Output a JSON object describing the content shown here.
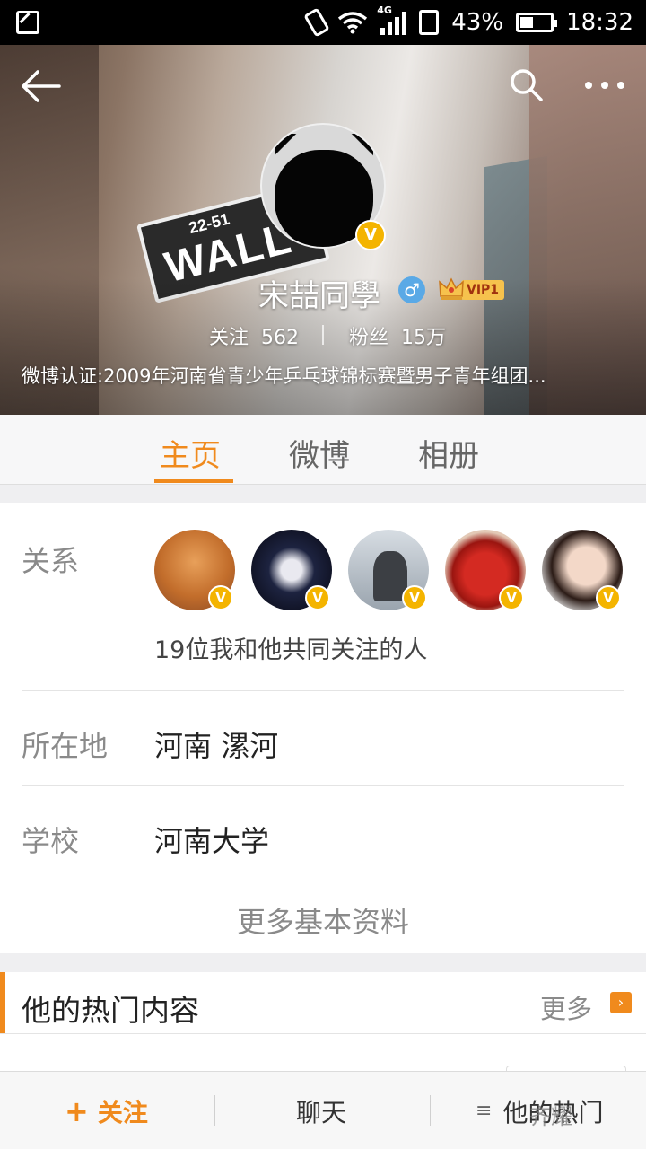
{
  "status_bar": {
    "network": "4G",
    "battery": "43%",
    "time": "18:32"
  },
  "header": {
    "street_sign_number": "22-51",
    "street_sign_name": "WALL",
    "username": "宋喆同學",
    "gender_symbol": "♂",
    "vip_label": "VIP1",
    "verified_mark": "V",
    "following_label": "关注",
    "following_count": "562",
    "followers_label": "粉丝",
    "followers_count": "15万",
    "verification": "微博认证:2009年河南省青少年乒乓球锦标赛暨男子青年组团..."
  },
  "tabs": [
    {
      "label": "主页",
      "active": true
    },
    {
      "label": "微博",
      "active": false
    },
    {
      "label": "相册",
      "active": false
    }
  ],
  "info": {
    "relation_label": "关系",
    "common_follow_text": "19位我和他共同关注的人",
    "location_label": "所在地",
    "location_value": "河南 漯河",
    "school_label": "学校",
    "school_value": "河南大学",
    "more_info_label": "更多基本资料"
  },
  "hot": {
    "title": "他的热门内容",
    "more_label": "更多",
    "arrow": "›"
  },
  "bottom_bar": {
    "follow_plus": "+",
    "follow_label": "关注",
    "chat_label": "聊天",
    "menu_glyph": "≡",
    "hot_label": "他的热门"
  },
  "watermark": "齐耀",
  "colors": {
    "accent": "#f08a1d",
    "vip_gold": "#f6c24d",
    "verified": "#f4b400",
    "gender_blue": "#5aa9e6"
  }
}
